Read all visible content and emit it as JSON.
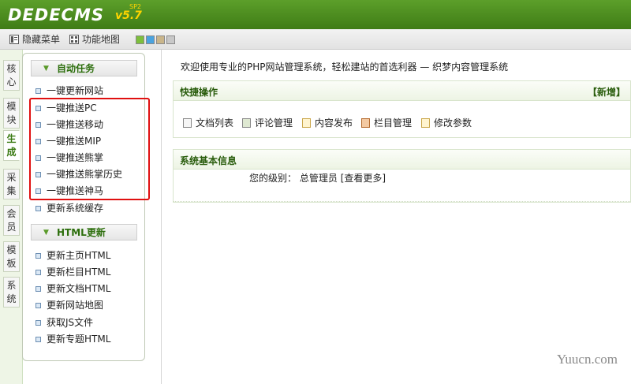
{
  "header": {
    "logo_text": "DEDECMS",
    "version": "v5.7",
    "build": "SP2",
    "colors": {
      "bar": "#4c8b1f",
      "logo": "#ffffff",
      "version": "#ffd400"
    }
  },
  "toolbar": {
    "hide_menu_label": "隐藏菜单",
    "site_map_label": "功能地图",
    "skin_colors": [
      "#7dbf3c",
      "#4aa3df",
      "#c9b58a",
      "#c8c8c8"
    ]
  },
  "left_tabs": [
    {
      "label_line1": "核",
      "label_line2": "心"
    },
    {
      "label_line1": "模",
      "label_line2": "块"
    },
    {
      "label_line1": "生",
      "label_line2": "成"
    },
    {
      "label_line1": "采",
      "label_line2": "集"
    },
    {
      "label_line1": "会",
      "label_line2": "员"
    },
    {
      "label_line1": "模",
      "label_line2": "板"
    },
    {
      "label_line1": "系",
      "label_line2": "统"
    }
  ],
  "menu": {
    "section1_title": "自动任务",
    "section1_items": [
      "一键更新网站",
      "一键推送PC",
      "一键推送移动",
      "一键推送MIP",
      "一键推送熊掌",
      "一键推送熊掌历史",
      "一键推送神马",
      "更新系统缓存"
    ],
    "section2_title": "HTML更新",
    "section2_items": [
      "更新主页HTML",
      "更新栏目HTML",
      "更新文档HTML",
      "更新网站地图",
      "获取JS文件",
      "更新专题HTML"
    ]
  },
  "main": {
    "welcome": "欢迎使用专业的PHP网站管理系统，轻松建站的首选利器 — 织梦内容管理系统",
    "quick_title": "快捷操作",
    "add_new": "【新增】",
    "quick_links": [
      "文档列表",
      "评论管理",
      "内容发布",
      "栏目管理",
      "修改参数"
    ],
    "info_title": "系统基本信息",
    "level_label": "您的级别：",
    "level_value": "总管理员",
    "see_more": "[查看更多]"
  },
  "watermark": "Yuucn.com"
}
